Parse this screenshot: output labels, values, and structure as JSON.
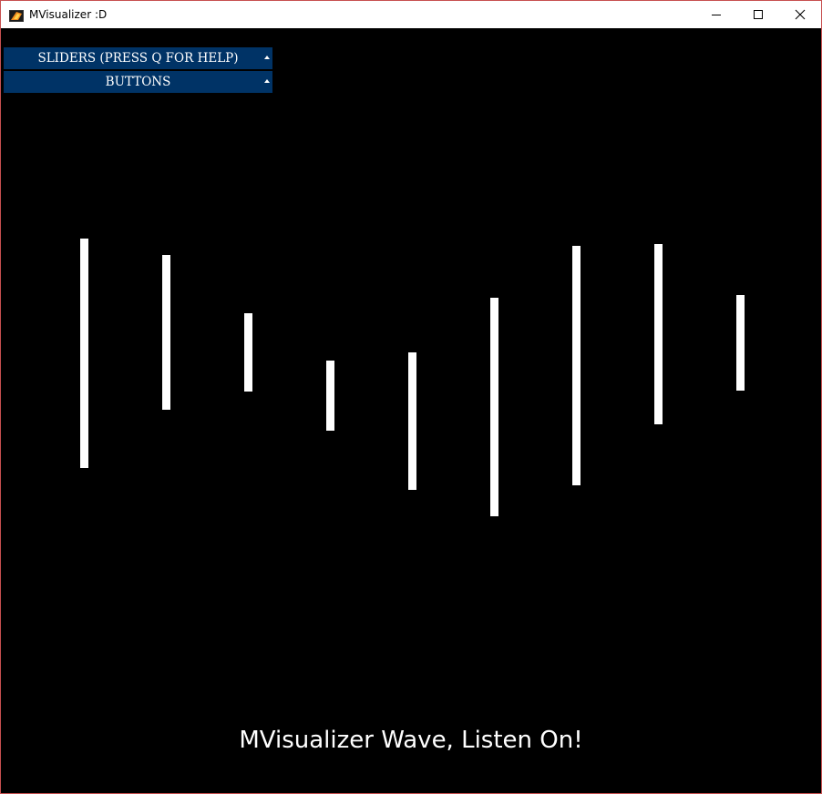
{
  "window": {
    "title": "MVisualizer :D",
    "controls": {
      "minimize_icon": "minimize-icon",
      "maximize_icon": "maximize-icon",
      "close_icon": "close-icon"
    }
  },
  "gui": {
    "panels": [
      {
        "label": "SLIDERS (PRESS Q FOR HELP)",
        "icon": "caret-up-icon"
      },
      {
        "label": "BUTTONS",
        "icon": "caret-up-icon"
      }
    ]
  },
  "visualizer": {
    "caption": "MVisualizer Wave, Listen On!",
    "bar_color": "#ffffff",
    "background_color": "#000000",
    "panel_color": "#003366",
    "bars": [
      {
        "top": 0.275,
        "bottom": 0.575
      },
      {
        "top": 0.297,
        "bottom": 0.499
      },
      {
        "top": 0.373,
        "bottom": 0.475
      },
      {
        "top": 0.435,
        "bottom": 0.527
      },
      {
        "top": 0.424,
        "bottom": 0.604
      },
      {
        "top": 0.352,
        "bottom": 0.638
      },
      {
        "top": 0.284,
        "bottom": 0.597
      },
      {
        "top": 0.282,
        "bottom": 0.518
      },
      {
        "top": 0.349,
        "bottom": 0.474
      }
    ]
  }
}
